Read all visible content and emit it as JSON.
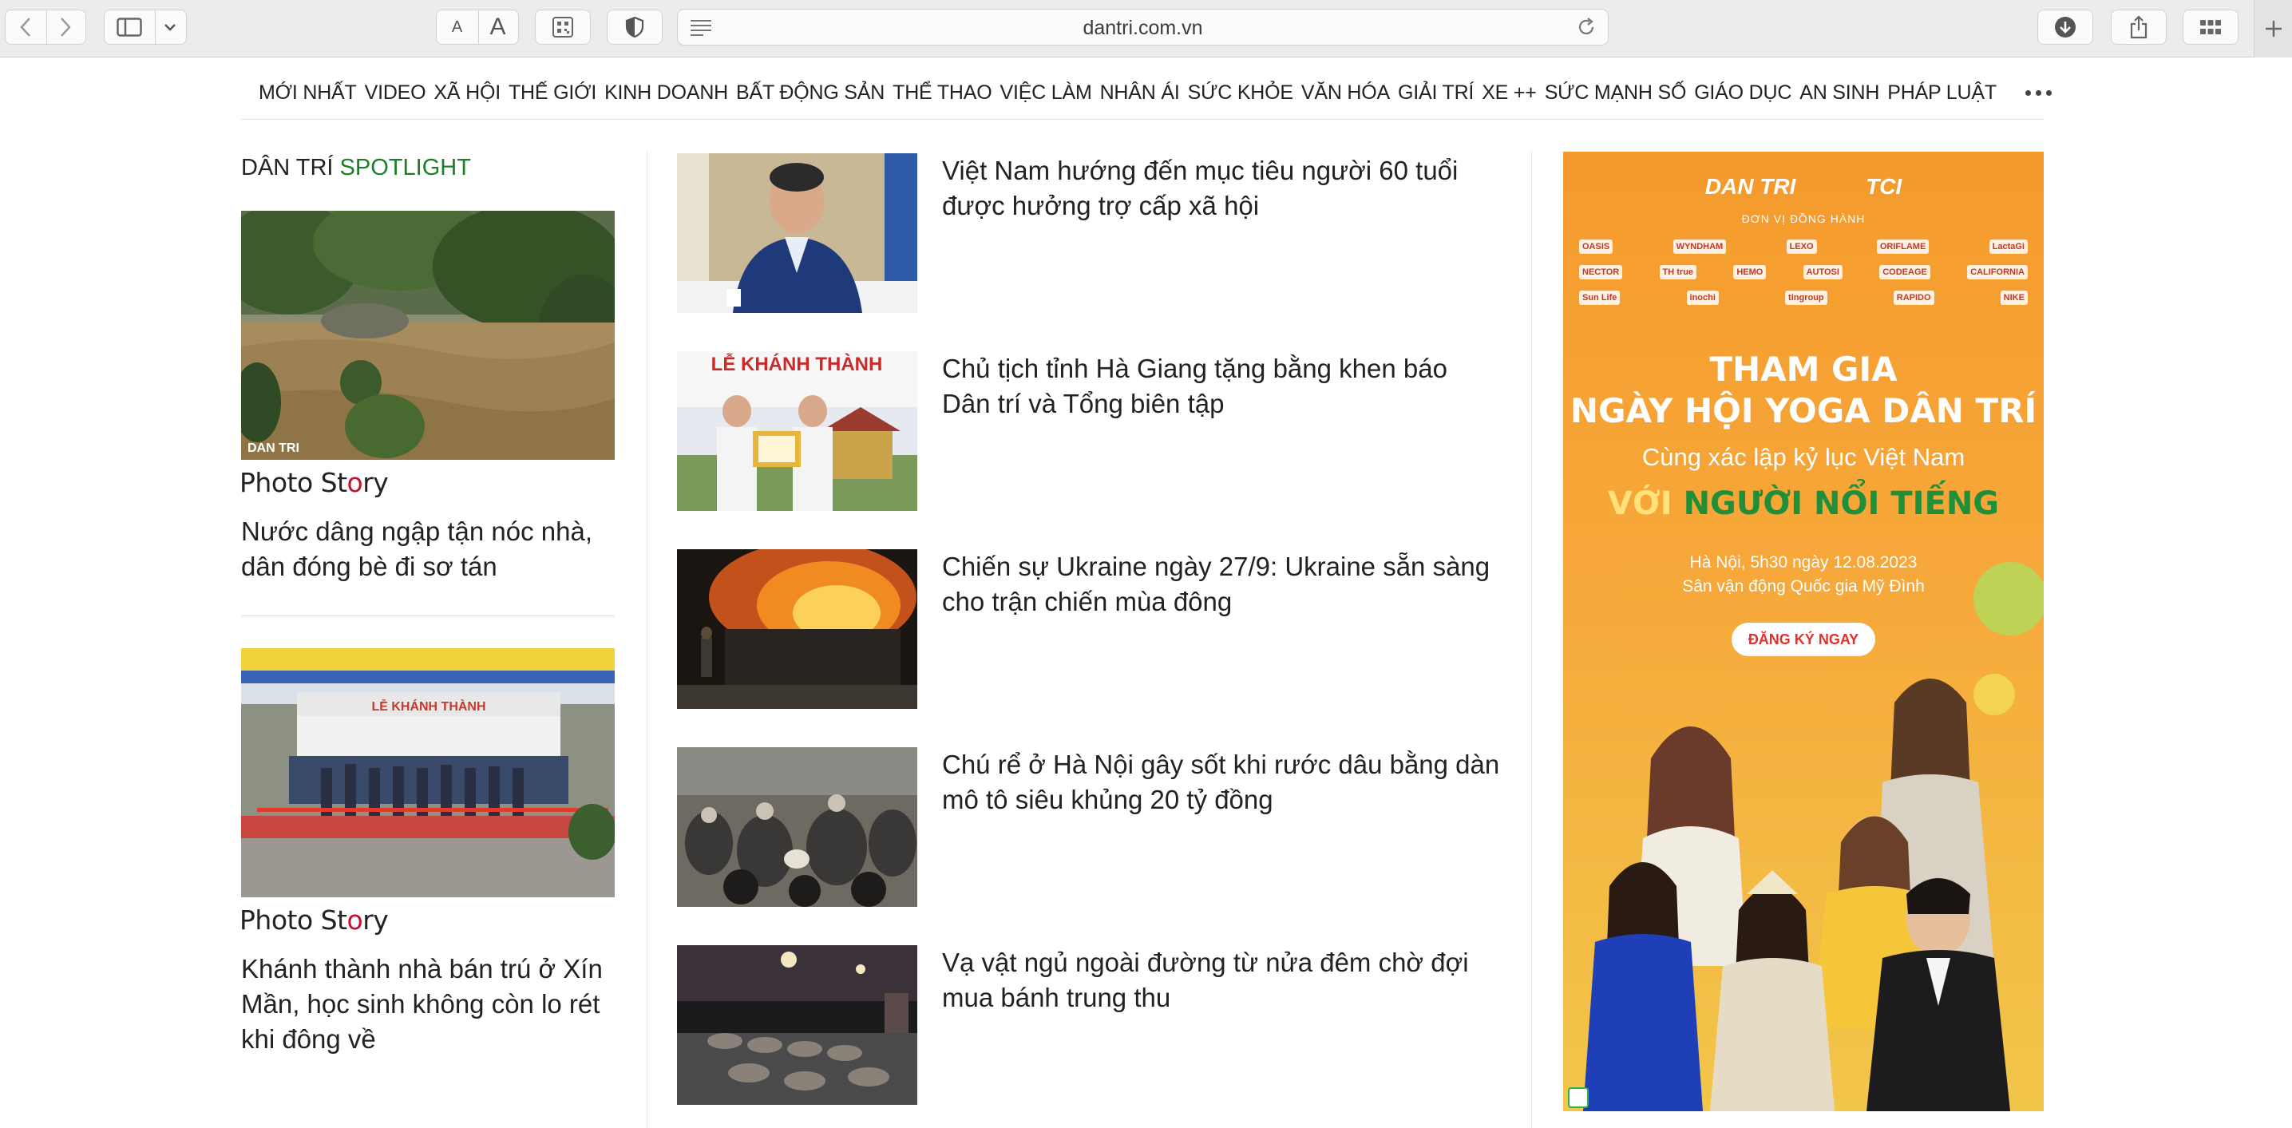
{
  "browser": {
    "url": "dantri.com.vn",
    "font_small": "A",
    "font_large": "A"
  },
  "nav": {
    "items": [
      "MỚI NHẤT",
      "VIDEO",
      "XÃ HỘI",
      "THẾ GIỚI",
      "KINH DOANH",
      "BẤT ĐỘNG SẢN",
      "THỂ THAO",
      "VIỆC LÀM",
      "NHÂN ÁI",
      "SỨC KHỎE",
      "VĂN HÓA",
      "GIẢI TRÍ",
      "XE ++",
      "SỨC MẠNH SỐ",
      "GIÁO DỤC",
      "AN SINH",
      "PHÁP LUẬT"
    ]
  },
  "spotlight": {
    "title_a": "DÂN TRÍ",
    "title_b": "SPOTLIGHT",
    "items": [
      {
        "label_pre": "Photo St",
        "label_o": "o",
        "label_post": "ry",
        "headline": "Nước dâng ngập tận nóc nhà, dân đóng bè đi sơ tán",
        "watermark": "DAN TRI"
      },
      {
        "label_pre": "Photo St",
        "label_o": "o",
        "label_post": "ry",
        "headline": "Khánh thành nhà bán trú ở Xín Mần, học sinh không còn lo rét khi đông về",
        "banner": "LỄ KHÁNH THÀNH"
      }
    ]
  },
  "articles": [
    {
      "title": "Việt Nam hướng đến mục tiêu người 60 tuổi được hưởng trợ cấp xã hội"
    },
    {
      "title": "Chủ tịch tỉnh Hà Giang tặng bằng khen báo Dân trí và Tổng biên tập",
      "banner": "LỄ KHÁNH THÀNH"
    },
    {
      "title": "Chiến sự Ukraine ngày 27/9: Ukraine sẵn sàng cho trận chiến mùa đông"
    },
    {
      "title": "Chú rể ở Hà Nội gây sốt khi rước dâu bằng dàn mô tô siêu khủng 20 tỷ đồng"
    },
    {
      "title": "Vạ vật ngủ ngoài đường từ nửa đêm chờ đợi mua bánh trung thu"
    }
  ],
  "ad": {
    "logo_left": "DAN TRI",
    "logo_right": "TCI",
    "cohost": "ĐƠN VỊ ĐỒNG HÀNH",
    "sponsors_row1": [
      "OASIS",
      "WYNDHAM",
      "LEXO",
      "ORIFLAME",
      "LactaGi"
    ],
    "sponsors_row2": [
      "NECTOR",
      "TH true",
      "HEMO",
      "AUTOSI",
      "CODEAGE",
      "CALIFORNIA"
    ],
    "sponsors_row3": [
      "Sun Life",
      "inochi",
      "tingroup",
      "RAPIDO",
      "NIKE"
    ],
    "headline_1": "THAM GIA",
    "headline_2": "NGÀY HỘI YOGA DÂN TRÍ",
    "subline": "Cùng xác lập kỷ lục Việt Nam",
    "green_a": "VỚI",
    "green_b": "NGƯỜI NỔI TIẾNG",
    "date_line": "Hà Nội, 5h30 ngày 12.08.2023",
    "venue_line": "Sân vận động Quốc gia Mỹ Đình",
    "cta": "ĐĂNG KÝ NGAY"
  }
}
